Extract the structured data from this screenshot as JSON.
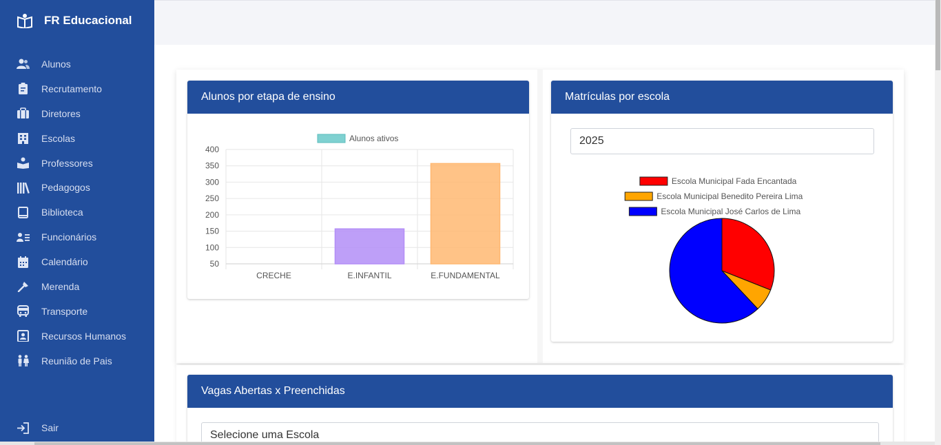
{
  "app": {
    "title": "FR Educacional"
  },
  "sidebar": {
    "items": [
      {
        "label": "Alunos",
        "icon": "users-icon"
      },
      {
        "label": "Recrutamento",
        "icon": "clipboard-icon"
      },
      {
        "label": "Diretores",
        "icon": "briefcase-icon"
      },
      {
        "label": "Escolas",
        "icon": "building-icon"
      },
      {
        "label": "Professores",
        "icon": "book-reader-icon"
      },
      {
        "label": "Pedagogos",
        "icon": "books-icon"
      },
      {
        "label": "Biblioteca",
        "icon": "book-icon"
      },
      {
        "label": "Funcionários",
        "icon": "id-list-icon"
      },
      {
        "label": "Calendário",
        "icon": "calendar-icon"
      },
      {
        "label": "Merenda",
        "icon": "utensils-icon"
      },
      {
        "label": "Transporte",
        "icon": "bus-icon"
      },
      {
        "label": "Recursos Humanos",
        "icon": "id-badge-icon"
      },
      {
        "label": "Reunião de Pais",
        "icon": "parents-icon"
      }
    ],
    "logout": {
      "label": "Sair",
      "icon": "sign-out-icon"
    }
  },
  "cards": {
    "students_by_stage": {
      "title": "Alunos por etapa de ensino"
    },
    "enrollments_by_school": {
      "title": "Matrículas por escola",
      "year_value": "2025"
    },
    "vacancies": {
      "title": "Vagas Abertas x Preenchidas",
      "school_select_placeholder": "Selecione uma Escola"
    }
  },
  "colors": {
    "sidebar": "#224e9c",
    "header": "#224e9c",
    "accent_teal": "#7fd1d1",
    "purple": "#b38ef7",
    "orange": "#ffb872",
    "red": "#ff0000",
    "amber": "#ffa500",
    "blue": "#0000ff"
  },
  "chart_data": [
    {
      "type": "bar",
      "categories": [
        "CRECHE",
        "E.INFANTIL",
        "E.FUNDAMENTAL"
      ],
      "series": [
        {
          "name": "Alunos ativos",
          "values": [
            0,
            157,
            357
          ]
        }
      ],
      "bar_colors": [
        "#7fd1d1",
        "#b38ef7",
        "#ffb872"
      ],
      "yticks": [
        50,
        100,
        150,
        200,
        250,
        300,
        350,
        400
      ],
      "ylim": [
        50,
        400
      ],
      "grid": true,
      "legend": "top"
    },
    {
      "type": "pie",
      "labels": [
        "Escola Municipal Fada Encantada",
        "Escola Municipal Benedito Pereira Lima",
        "Escola Municipal José Carlos de Lima"
      ],
      "values": [
        31,
        7,
        62
      ],
      "colors": [
        "#ff0000",
        "#ffa500",
        "#0000ff"
      ],
      "legend": "top"
    }
  ]
}
